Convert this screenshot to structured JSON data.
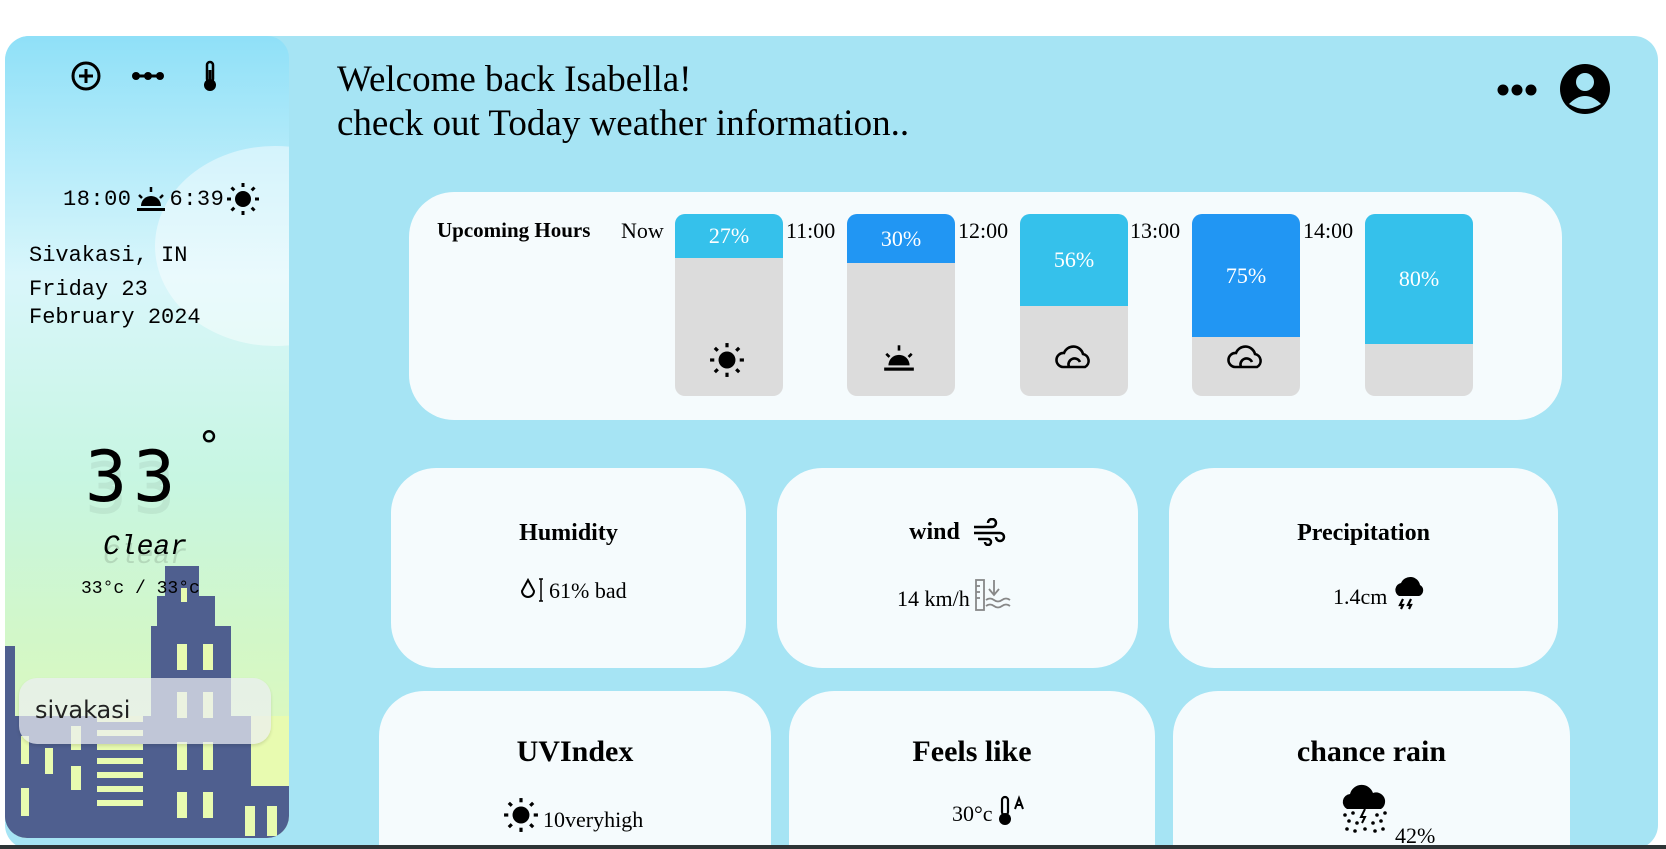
{
  "sidebar": {
    "sunset_time": "18:00",
    "sunrise_time": "6:39",
    "location": "Sivakasi, IN",
    "date_line1": "Friday 23",
    "date_line2": "February 2024",
    "temperature": "33",
    "degree_mark": "°",
    "condition": "Clear",
    "range": "33°c / 33°c",
    "search_value": "sivakasi"
  },
  "header": {
    "line1": "Welcome back Isabella!",
    "line2": "check out Today weather information.."
  },
  "hours": {
    "title": "Upcoming Hours",
    "items": [
      {
        "time": "Now",
        "percent": "27%",
        "level": 0.27,
        "color": "#35c1eb",
        "icon": "sun-icon"
      },
      {
        "time": "11:00",
        "percent": "30%",
        "level": 0.3,
        "color": "#2196f3",
        "icon": "sunset-icon"
      },
      {
        "time": "12:00",
        "percent": "56%",
        "level": 0.56,
        "color": "#35c1eb",
        "icon": "cloud-icon"
      },
      {
        "time": "13:00",
        "percent": "75%",
        "level": 0.75,
        "color": "#2196f3",
        "icon": "cloud-icon"
      },
      {
        "time": "14:00",
        "percent": "80%",
        "level": 0.8,
        "color": "#35c1eb",
        "icon": ""
      }
    ]
  },
  "cards": {
    "humidity": {
      "title": "Humidity",
      "value": "61% bad"
    },
    "wind": {
      "title": "wind",
      "value": "14 km/h"
    },
    "precipitation": {
      "title": "Precipitation",
      "value": "1.4cm"
    },
    "uv": {
      "title": "UVIndex",
      "value": "10veryhigh"
    },
    "feels": {
      "title": "Feels like",
      "value": "30°c"
    },
    "rain": {
      "title": "chance rain",
      "value": "42%"
    }
  },
  "colors": {
    "background": "#a6e4f4",
    "card": "#f5fbfd",
    "bar_light": "#35c1eb",
    "bar_dark": "#2196f3",
    "bar_empty": "#dcdcdc",
    "city": "#4f5f8f"
  }
}
